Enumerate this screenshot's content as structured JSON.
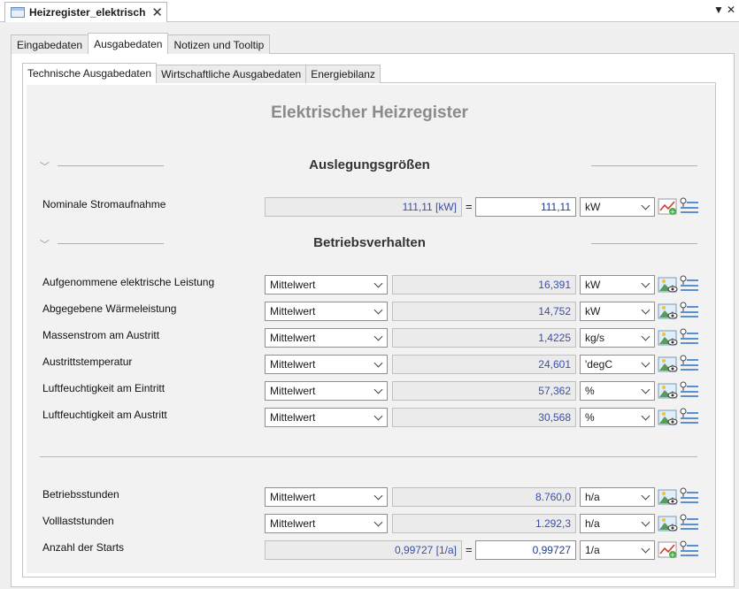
{
  "doc_tab": {
    "title": "Heizregister_elektrisch"
  },
  "outer_tabs": [
    {
      "label": "Eingabedaten"
    },
    {
      "label": "Ausgabedaten"
    },
    {
      "label": "Notizen und Tooltip"
    }
  ],
  "inner_tabs": [
    {
      "label": "Technische Ausgabedaten"
    },
    {
      "label": "Wirtschaftliche Ausgabedaten"
    },
    {
      "label": "Energiebilanz"
    }
  ],
  "main_title": "Elektrischer Heizregister",
  "sections": {
    "auslegung": "Auslegungsgrößen",
    "betrieb": "Betriebsverhalten"
  },
  "nominal": {
    "label": "Nominale Stromaufnahme",
    "computed": "111,11 [kW]",
    "equals": "=",
    "value": "111,11",
    "unit": "kW"
  },
  "betrieb_rows": [
    {
      "label": "Aufgenommene elektrische Leistung",
      "mode": "Mittelwert",
      "value": "16,391",
      "unit": "kW"
    },
    {
      "label": "Abgegebene Wärmeleistung",
      "mode": "Mittelwert",
      "value": "14,752",
      "unit": "kW"
    },
    {
      "label": "Massenstrom am Austritt",
      "mode": "Mittelwert",
      "value": "1,4225",
      "unit": "kg/s"
    },
    {
      "label": "Austrittstemperatur",
      "mode": "Mittelwert",
      "value": "24,601",
      "unit": "'degC"
    },
    {
      "label": "Luftfeuchtigkeit am Eintritt",
      "mode": "Mittelwert",
      "value": "57,362",
      "unit": "%"
    },
    {
      "label": "Luftfeuchtigkeit am Austritt",
      "mode": "Mittelwert",
      "value": "30,568",
      "unit": "%"
    }
  ],
  "stats_rows": [
    {
      "label": "Betriebsstunden",
      "mode": "Mittelwert",
      "value": "8.760,0",
      "unit": "h/a"
    },
    {
      "label": "Volllaststunden",
      "mode": "Mittelwert",
      "value": "1.292,3",
      "unit": "h/a"
    }
  ],
  "starts": {
    "label": "Anzahl der Starts",
    "computed": "0,99727 [1/a]",
    "equals": "=",
    "value": "0,99727",
    "unit": "1/a"
  },
  "icons": {
    "chart": "line-chart-add-icon",
    "landscape": "landscape-eye-icon",
    "list": "pin-list-icon"
  },
  "colors": {
    "value_text": "#3a4fa8",
    "title": "#8a8a8a",
    "content_bg": "#f2f2f2"
  }
}
